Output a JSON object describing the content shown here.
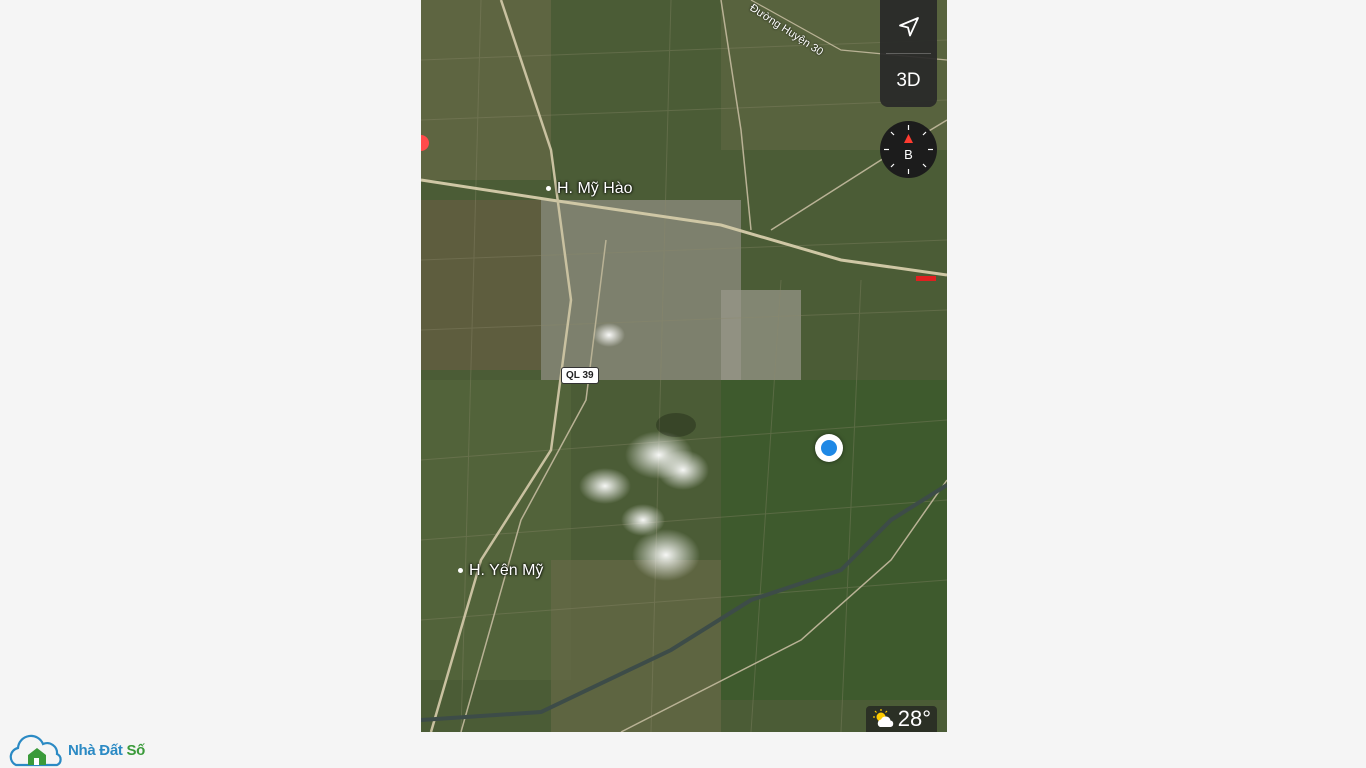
{
  "map": {
    "places": [
      {
        "id": "my-hao",
        "label": "H. Mỹ Hào"
      },
      {
        "id": "yen-my",
        "label": "H. Yên Mỹ"
      }
    ],
    "road_label": "Đường Huyện 30",
    "route_shield": "QL 39",
    "controls": {
      "location_icon": "navigation-arrow-icon",
      "mode_3d_label": "3D",
      "compass_label": "B"
    },
    "weather": {
      "icon": "partly-cloudy-icon",
      "temperature": "28°"
    }
  },
  "watermark": {
    "icon": "cloud-house-icon",
    "brand_part1": "Nhà Đất",
    "brand_part2": "Số"
  }
}
